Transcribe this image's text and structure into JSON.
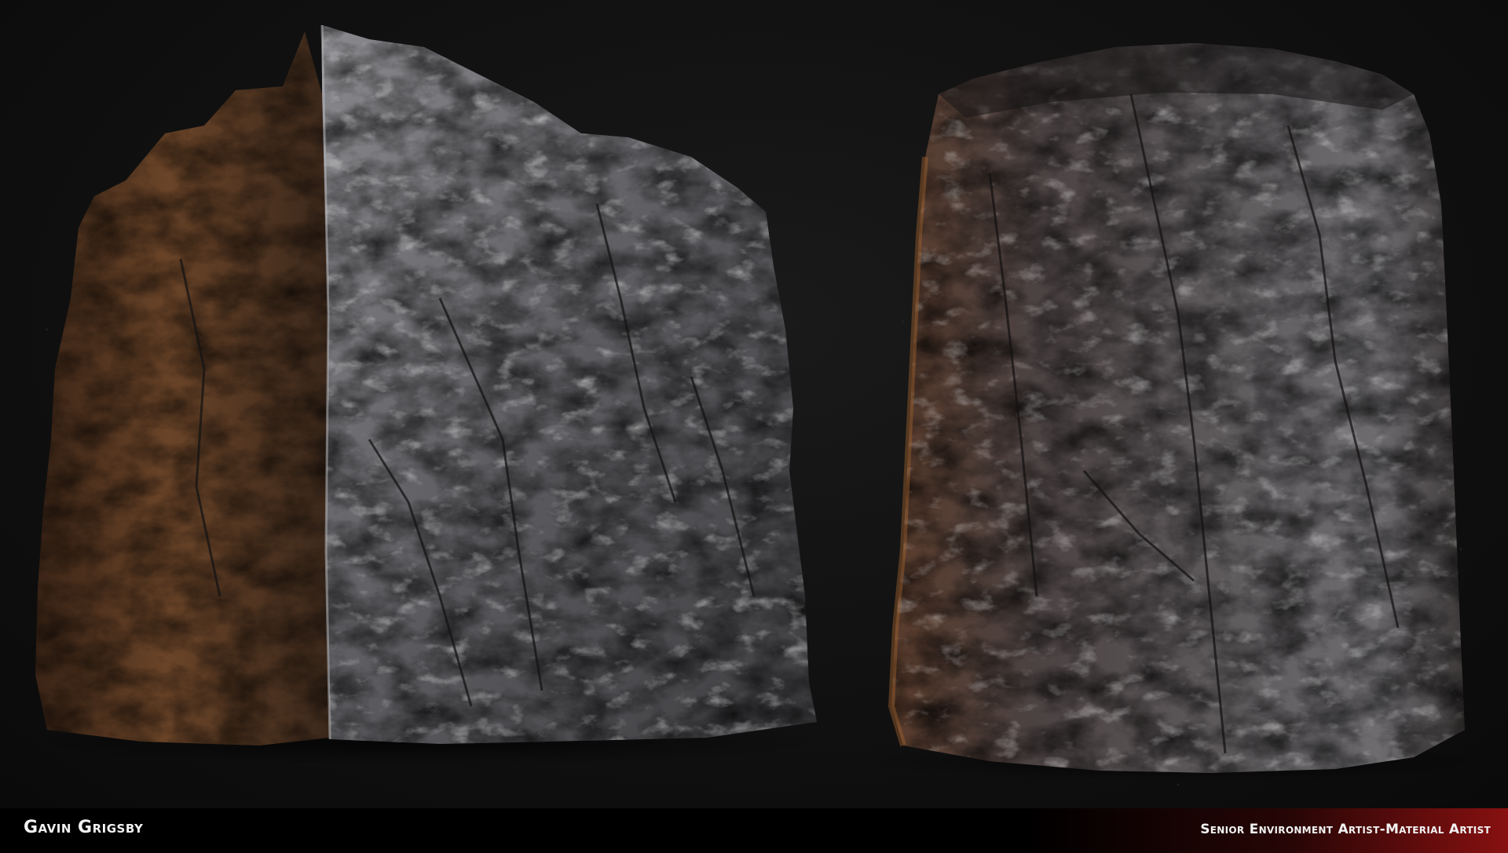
{
  "footer": {
    "artist_name": "Gavin Grigsby",
    "artist_title": "Senior Environment Artist-Material Artist",
    "accent_color": "#961212"
  },
  "scene": {
    "background_color": "#121212",
    "objects": [
      {
        "name": "rock-material-cube",
        "left_face_color": "#5a3a24",
        "right_face_color": "#6e6e70"
      },
      {
        "name": "rock-material-cylinder",
        "base_color": "#4a4444"
      }
    ]
  }
}
